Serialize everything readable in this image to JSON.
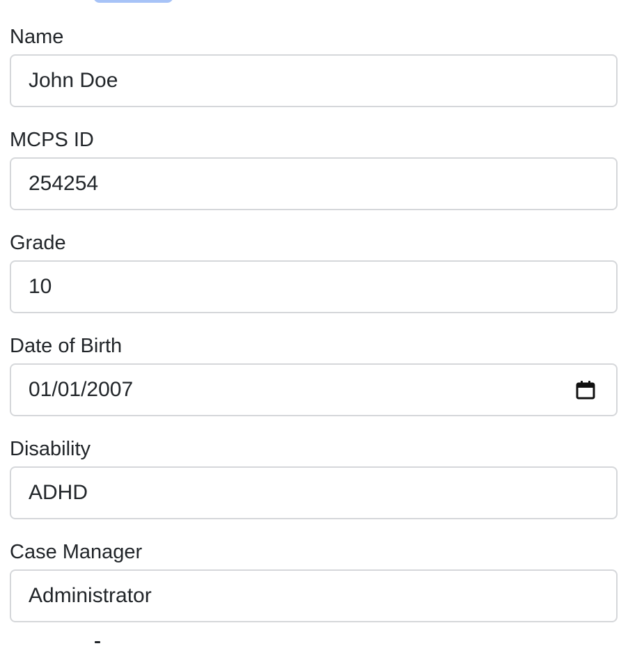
{
  "form": {
    "name": {
      "label": "Name",
      "value": "John Doe"
    },
    "mcps_id": {
      "label": "MCPS ID",
      "value": "254254"
    },
    "grade": {
      "label": "Grade",
      "value": "10"
    },
    "date_of_birth": {
      "label": "Date of Birth",
      "value": "01/01/2007",
      "icon": "calendar-icon"
    },
    "disability": {
      "label": "Disability",
      "value": "ADHD"
    },
    "case_manager": {
      "label": "Case Manager",
      "value": "Administrator"
    }
  },
  "colors": {
    "input_border": "#d5d7da",
    "text": "#212529",
    "top_pill": "#a7c3f7"
  }
}
